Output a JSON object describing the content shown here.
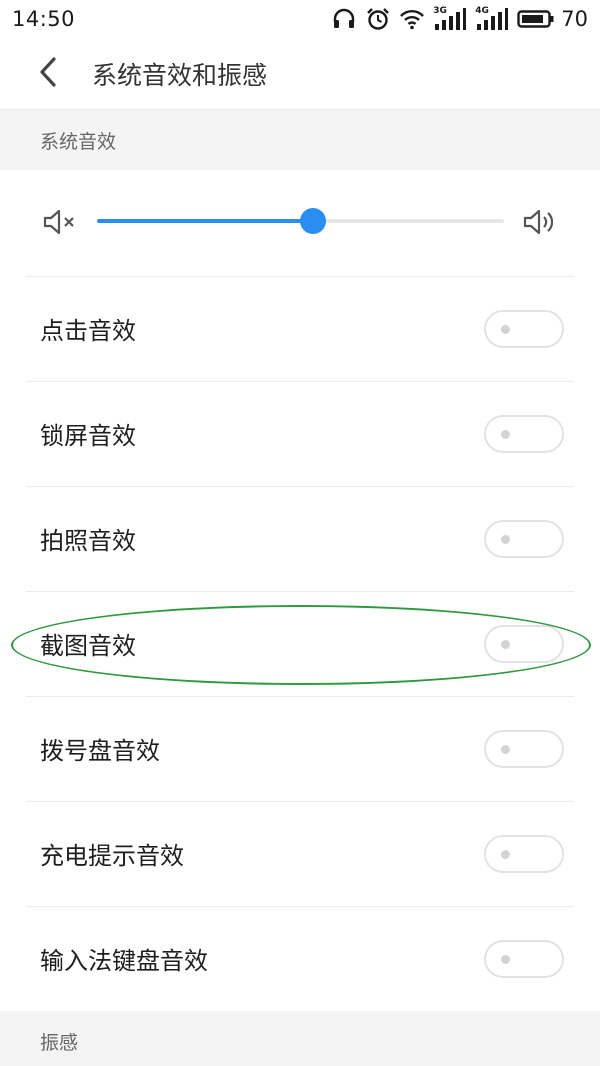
{
  "status_bar": {
    "time": "14:50",
    "icons": [
      "headphones-icon",
      "alarm-icon",
      "wifi-icon",
      "signal-3g-icon",
      "signal-4g-icon",
      "battery-icon"
    ],
    "network_labels": [
      "3G",
      "4G"
    ],
    "battery": "70"
  },
  "header": {
    "title": "系统音效和振感"
  },
  "sections": {
    "system_sound": "系统音效",
    "vibration": "振感"
  },
  "volume": {
    "level": 0.53,
    "mute_icon": "volume-mute-icon",
    "max_icon": "volume-up-icon",
    "accent": "#2a8ef0"
  },
  "settings": [
    {
      "label": "点击音效",
      "enabled": false
    },
    {
      "label": "锁屏音效",
      "enabled": false
    },
    {
      "label": "拍照音效",
      "enabled": false
    },
    {
      "label": "截图音效",
      "enabled": false
    },
    {
      "label": "拨号盘音效",
      "enabled": false
    },
    {
      "label": "充电提示音效",
      "enabled": false
    },
    {
      "label": "输入法键盘音效",
      "enabled": false
    }
  ],
  "annotation": {
    "highlighted_item": "截图音效",
    "color": "#2e9a3e"
  }
}
